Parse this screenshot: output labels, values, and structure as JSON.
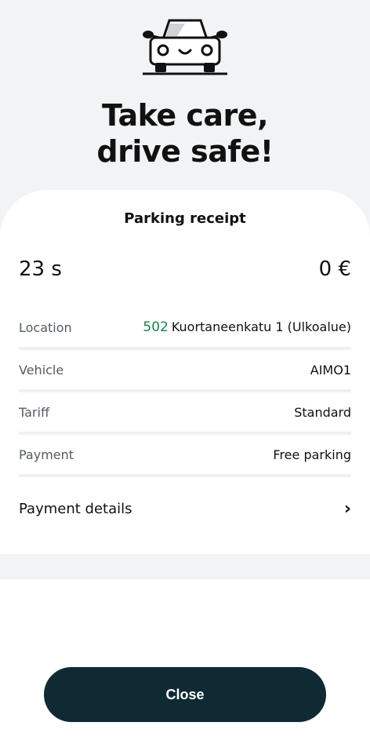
{
  "hero": {
    "title_line1": "Take care,",
    "title_line2": "drive safe!",
    "icon": "car-icon"
  },
  "receipt": {
    "title": "Parking receipt",
    "duration": "23 s",
    "price": "0 €",
    "rows": [
      {
        "label": "Location",
        "zone": "502",
        "value": "Kuortaneenkatu 1 (Ulkoalue)"
      },
      {
        "label": "Vehicle",
        "value": "AIMO1"
      },
      {
        "label": "Tariff",
        "value": "Standard"
      },
      {
        "label": "Payment",
        "value": "Free parking"
      }
    ],
    "payment_details_label": "Payment details",
    "chevron_icon": "chevron-right-icon"
  },
  "actions": {
    "close_label": "Close"
  },
  "colors": {
    "background": "#f2f3f5",
    "zone_green": "#1a7f4b",
    "button": "#0f2a33"
  }
}
